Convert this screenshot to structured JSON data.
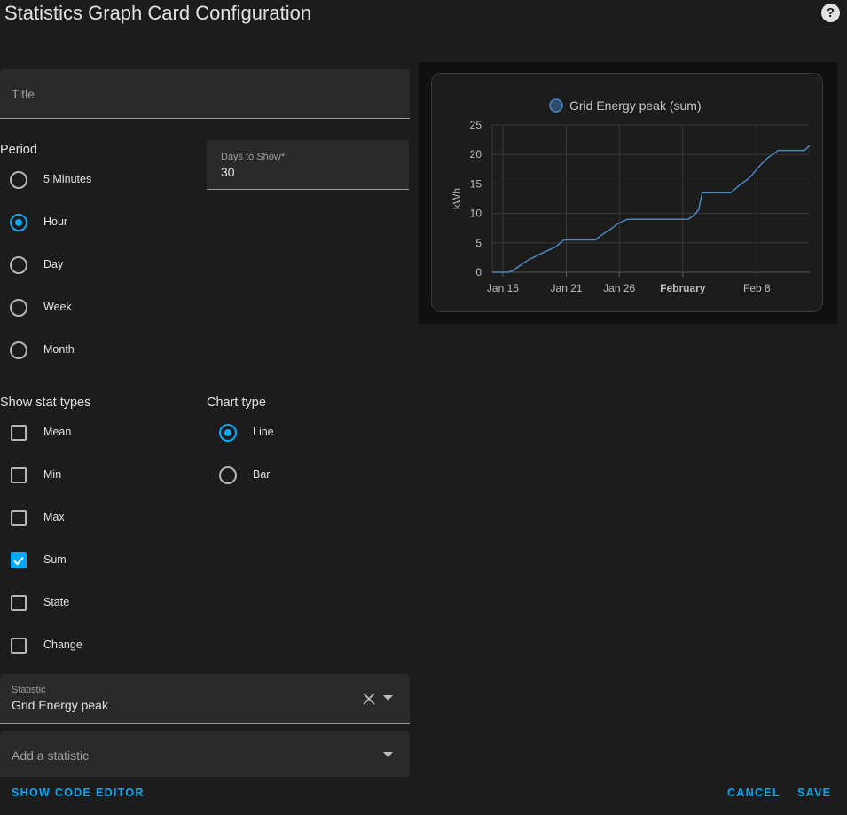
{
  "dialog": {
    "title": "Statistics Graph Card Configuration",
    "help_icon": "help-circle-icon"
  },
  "title_field": {
    "placeholder": "Title",
    "value": ""
  },
  "period": {
    "label": "Period",
    "options": [
      {
        "label": "5 Minutes",
        "checked": false
      },
      {
        "label": "Hour",
        "checked": true
      },
      {
        "label": "Day",
        "checked": false
      },
      {
        "label": "Week",
        "checked": false
      },
      {
        "label": "Month",
        "checked": false
      }
    ]
  },
  "days_field": {
    "label": "Days to Show*",
    "value": "30"
  },
  "stat_types": {
    "label": "Show stat types",
    "options": [
      {
        "label": "Mean",
        "checked": false
      },
      {
        "label": "Min",
        "checked": false
      },
      {
        "label": "Max",
        "checked": false
      },
      {
        "label": "Sum",
        "checked": true
      },
      {
        "label": "State",
        "checked": false
      },
      {
        "label": "Change",
        "checked": false
      }
    ]
  },
  "chart_type": {
    "label": "Chart type",
    "options": [
      {
        "label": "Line",
        "checked": true
      },
      {
        "label": "Bar",
        "checked": false
      }
    ]
  },
  "statistic_field": {
    "label": "Statistic",
    "value": "Grid Energy peak",
    "clear_icon": "close-icon",
    "dropdown_icon": "arrow-drop-down-icon"
  },
  "add_statistic": {
    "placeholder": "Add a statistic",
    "dropdown_icon": "arrow-drop-down-icon"
  },
  "footer": {
    "code_editor": "SHOW CODE EDITOR",
    "cancel": "CANCEL",
    "save": "SAVE"
  },
  "colors": {
    "accent": "#03a9f4",
    "series": "#4a86c0",
    "background": "#1c1c1c"
  },
  "chart_data": {
    "type": "line",
    "legend": "top",
    "grid": true,
    "ylabel": "kWh",
    "ylim": [
      0,
      25
    ],
    "yticks": [
      "0",
      "5",
      "10",
      "15",
      "20",
      "25"
    ],
    "xlim": [
      "2022-01-14",
      "2022-02-13"
    ],
    "xticks": [
      {
        "date": "2022-01-15",
        "label": "Jan 15",
        "bold": false
      },
      {
        "date": "2022-01-21",
        "label": "Jan 21",
        "bold": false
      },
      {
        "date": "2022-01-26",
        "label": "Jan 26",
        "bold": false
      },
      {
        "date": "2022-02-01",
        "label": "February",
        "bold": true
      },
      {
        "date": "2022-02-08",
        "label": "Feb 8",
        "bold": false
      }
    ],
    "series": [
      {
        "name": "Grid Energy peak (sum)",
        "color": "#4a86c0",
        "points": [
          [
            "2022-01-14T00:00",
            0
          ],
          [
            "2022-01-15T12:00",
            0
          ],
          [
            "2022-01-16T00:00",
            0.3
          ],
          [
            "2022-01-16T12:00",
            1.0
          ],
          [
            "2022-01-17T00:00",
            1.6
          ],
          [
            "2022-01-17T12:00",
            2.2
          ],
          [
            "2022-01-18T00:00",
            2.6
          ],
          [
            "2022-01-18T12:00",
            3.1
          ],
          [
            "2022-01-19T00:00",
            3.5
          ],
          [
            "2022-01-19T12:00",
            3.9
          ],
          [
            "2022-01-20T00:00",
            4.3
          ],
          [
            "2022-01-20T18:00",
            5.5
          ],
          [
            "2022-01-23T18:00",
            5.5
          ],
          [
            "2022-01-24T06:00",
            6.2
          ],
          [
            "2022-01-24T18:00",
            6.8
          ],
          [
            "2022-01-25T06:00",
            7.4
          ],
          [
            "2022-01-25T18:00",
            8.1
          ],
          [
            "2022-01-26T06:00",
            8.6
          ],
          [
            "2022-01-26T18:00",
            9.0
          ],
          [
            "2022-02-01T12:00",
            9.0
          ],
          [
            "2022-02-02T00:00",
            9.6
          ],
          [
            "2022-02-02T12:00",
            10.6
          ],
          [
            "2022-02-02T20:00",
            13.5
          ],
          [
            "2022-02-05T12:00",
            13.5
          ],
          [
            "2022-02-06T00:00",
            14.2
          ],
          [
            "2022-02-06T12:00",
            15.0
          ],
          [
            "2022-02-07T00:00",
            15.6
          ],
          [
            "2022-02-07T12:00",
            16.4
          ],
          [
            "2022-02-08T00:00",
            17.5
          ],
          [
            "2022-02-08T12:00",
            18.5
          ],
          [
            "2022-02-09T00:00",
            19.4
          ],
          [
            "2022-02-09T12:00",
            20.0
          ],
          [
            "2022-02-10T00:00",
            20.7
          ],
          [
            "2022-02-12T12:00",
            20.7
          ],
          [
            "2022-02-13T00:00",
            21.5
          ]
        ]
      }
    ]
  }
}
